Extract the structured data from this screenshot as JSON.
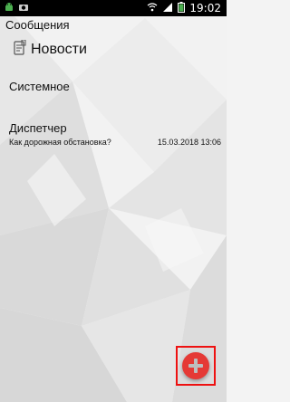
{
  "status_bar": {
    "time": "19:02",
    "colors": {
      "background": "#000000",
      "battery_level_color": "#4caf50"
    },
    "icons": [
      "android-icon",
      "camera-icon",
      "wifi-icon",
      "signal-icon",
      "battery-icon"
    ]
  },
  "app_bar": {
    "title": "Сообщения"
  },
  "section": {
    "title": "Новости",
    "icon": "news-icon"
  },
  "list": {
    "items": [
      {
        "name": "Системное",
        "preview": "",
        "time": ""
      },
      {
        "name": "Диспетчер",
        "preview": "Как дорожная обстановка?",
        "time": "15.03.2018 13:06"
      }
    ]
  },
  "fab": {
    "icon": "plus-icon",
    "color": "#e53935",
    "highlight_color": "#e11111"
  }
}
